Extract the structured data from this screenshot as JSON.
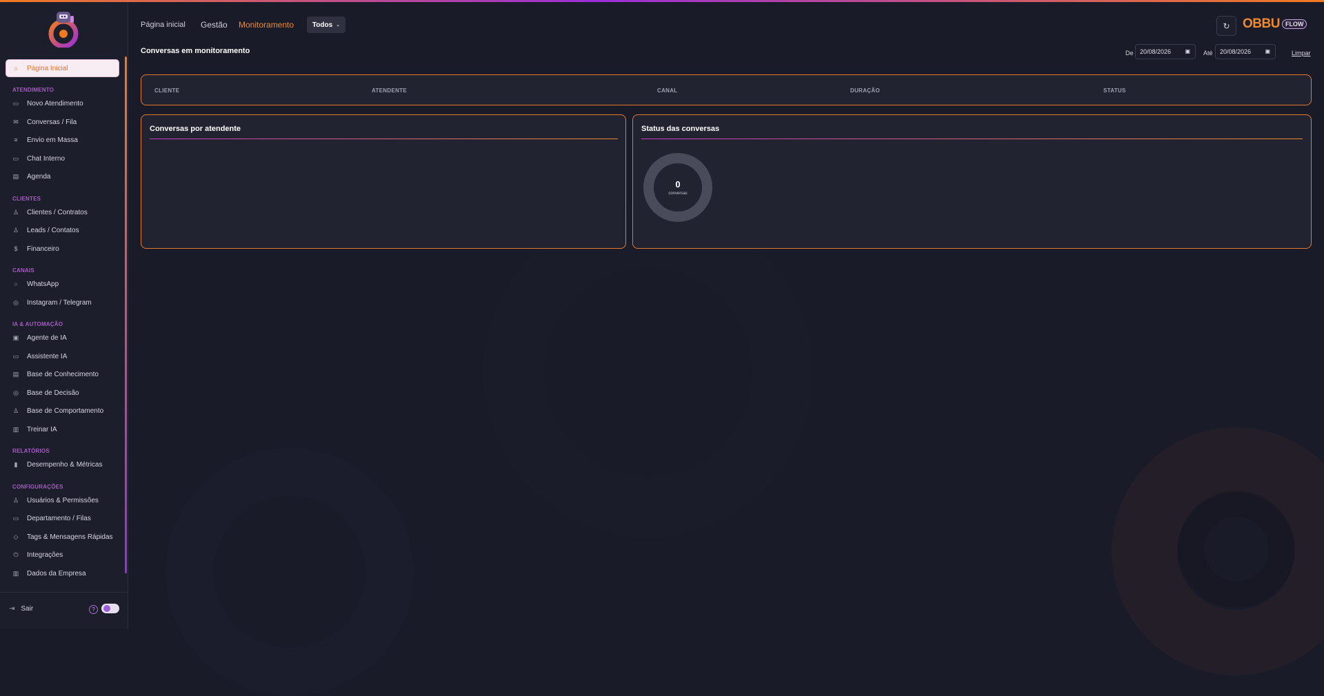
{
  "sidebar": {
    "active_item": {
      "label": "Página Inicial",
      "icon": "home-icon"
    },
    "sections": {
      "atendimento": {
        "title": "ATENDIMENTO",
        "items": [
          {
            "label": "Novo Atendimento",
            "icon": "chat-plus-icon"
          },
          {
            "label": "Conversas / Fila",
            "icon": "mail-icon"
          },
          {
            "label": "Envio em Massa",
            "icon": "list-icon"
          },
          {
            "label": "Chat Interno",
            "icon": "chat-bubble-icon"
          },
          {
            "label": "Agenda",
            "icon": "calendar-icon"
          }
        ]
      },
      "clientes": {
        "title": "CLIENTES",
        "items": [
          {
            "label": "Clientes / Contratos",
            "icon": "user-icon"
          },
          {
            "label": "Leads / Contatos",
            "icon": "users-icon"
          },
          {
            "label": "Financeiro",
            "icon": "dollar-icon"
          }
        ]
      },
      "canais": {
        "title": "CANAIS",
        "items": [
          {
            "label": "WhatsApp",
            "icon": "whatsapp-icon"
          },
          {
            "label": "Instagram / Telegram",
            "icon": "instagram-icon"
          }
        ]
      },
      "ia": {
        "title": "IA & AUTOMAÇÃO",
        "items": [
          {
            "label": "Agente de IA",
            "icon": "robot-icon"
          },
          {
            "label": "Assistente IA",
            "icon": "chat-ai-icon"
          },
          {
            "label": "Base de Conhecimento",
            "icon": "book-icon"
          },
          {
            "label": "Base de Decisão",
            "icon": "target-icon"
          },
          {
            "label": "Base de Comportamento",
            "icon": "person-icon"
          },
          {
            "label": "Treinar IA",
            "icon": "document-icon"
          }
        ]
      },
      "relatorios": {
        "title": "RELATÓRIOS",
        "items": [
          {
            "label": "Desempenho & Métricas",
            "icon": "bar-chart-icon"
          }
        ]
      },
      "configuracoes": {
        "title": "CONFIGURAÇÕES",
        "items": [
          {
            "label": "Usuários & Permissões",
            "icon": "user-settings-icon"
          },
          {
            "label": "Departamento / Filas",
            "icon": "briefcase-icon"
          },
          {
            "label": "Tags & Mensagens Rápidas",
            "icon": "tag-icon"
          },
          {
            "label": "Integrações",
            "icon": "plug-icon"
          },
          {
            "label": "Dados da Empresa",
            "icon": "building-icon"
          }
        ]
      }
    },
    "footer": {
      "logout_label": "Sair",
      "help_glyph": "?"
    }
  },
  "header": {
    "nav": [
      {
        "label": "Página inicial"
      },
      {
        "label": "Gestão"
      },
      {
        "label": "Monitoramento",
        "active": true
      }
    ],
    "filter_select": {
      "value": "Todos"
    },
    "brand": {
      "text": "OBBU",
      "badge": "FLOW"
    }
  },
  "page": {
    "title": "Conversas em monitoramento",
    "date_filter": {
      "from_label": "De",
      "from_value": "20/08/2026",
      "to_label": "Até",
      "to_value": "20/08/2026",
      "clear_label": "Limpar"
    }
  },
  "table": {
    "columns": [
      "CLIENTE",
      "ATENDENTE",
      "CANAL",
      "DURAÇÃO",
      "STATUS"
    ],
    "rows": []
  },
  "panels": {
    "by_agent": {
      "title": "Conversas por atendente"
    },
    "status": {
      "title": "Status das conversas",
      "total": "0",
      "total_label": "conversas"
    }
  },
  "colors": {
    "accent": "#f08a2c",
    "secondary": "#9b2fd8",
    "background": "#1a1b29"
  }
}
